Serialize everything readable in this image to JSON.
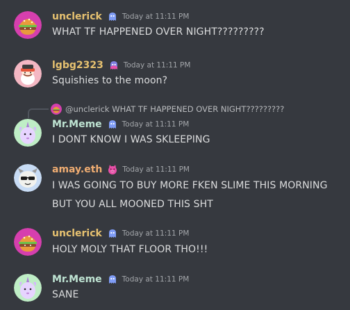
{
  "colors": {
    "background": "#36393f",
    "username_gold": "#e6c170",
    "username_teal": "#bfe4d3",
    "username_orange": "#f0ad72",
    "badge_blue": "#7f9cf5",
    "badge_pink": "#e84fa8"
  },
  "reply": {
    "mention": "@unclerick",
    "text": "WHAT TF HAPPENED OVER NIGHT?????????"
  },
  "messages": [
    {
      "user": "unclerick",
      "time": "Today at 11:11 PM",
      "lines": [
        "WHAT TF HAPPENED OVER NIGHT?????????"
      ],
      "avatar": "burger-avatar",
      "badge": "ghost-blue"
    },
    {
      "user": "lgbg2323",
      "time": "Today at 11:11 PM",
      "lines": [
        "Squishies to the moon?"
      ],
      "avatar": "monkey-avatar",
      "badge": "ghost-pink"
    },
    {
      "user": "Mr.Meme",
      "time": "Today at 11:11 PM",
      "lines": [
        "I DONT KNOW I WAS SKLEEPING"
      ],
      "avatar": "unicorn-avatar",
      "badge": "ghost-blue"
    },
    {
      "user": "amay.eth",
      "time": "Today at 11:11 PM",
      "lines": [
        "I WAS GOING TO BUY MORE FKEN SLIME THIS MORNING",
        "BUT YOU ALL MOONED THIS SHT"
      ],
      "avatar": "sunglasses-avatar",
      "badge": "pig-pink"
    },
    {
      "user": "unclerick",
      "time": "Today at 11:11 PM",
      "lines": [
        "HOLY MOLY THAT FLOOR THO!!!"
      ],
      "avatar": "burger-avatar",
      "badge": "ghost-blue"
    },
    {
      "user": "Mr.Meme",
      "time": "Today at 11:11 PM",
      "lines": [
        "SANE"
      ],
      "avatar": "unicorn-avatar",
      "badge": "ghost-blue"
    }
  ]
}
